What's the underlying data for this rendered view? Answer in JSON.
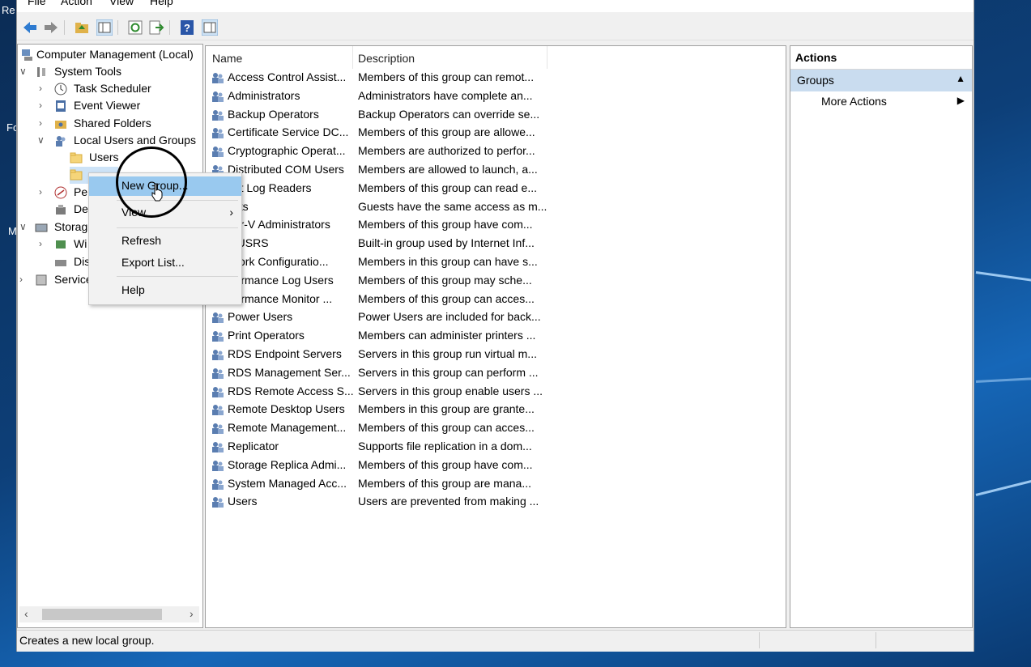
{
  "desktop": {
    "left_labels": [
      "Re",
      "Fo",
      "M"
    ]
  },
  "menubar": {
    "items": [
      "File",
      "Action",
      "View",
      "Help"
    ]
  },
  "toolbar": {
    "buttons": [
      "back-icon",
      "forward-icon",
      "up-folder-icon",
      "show-hide-console-tree-icon",
      "refresh-icon",
      "export-list-icon",
      "help-icon",
      "show-hide-action-pane-icon"
    ]
  },
  "tree": {
    "root": "Computer Management (Local)",
    "system_tools": "System Tools",
    "task_scheduler": "Task Scheduler",
    "event_viewer": "Event Viewer",
    "shared_folders": "Shared Folders",
    "local_users_groups": "Local Users and Groups",
    "users": "Users",
    "performance": "Per",
    "device_manager": "Dev",
    "storage": "Storag",
    "windows_backup": "Wi",
    "disk_management": "Dis",
    "services": "Service"
  },
  "list": {
    "col_name": "Name",
    "col_description": "Description",
    "rows": [
      {
        "name": "Access Control Assist...",
        "desc": "Members of this group can remot..."
      },
      {
        "name": "Administrators",
        "desc": "Administrators have complete an..."
      },
      {
        "name": "Backup Operators",
        "desc": "Backup Operators can override se..."
      },
      {
        "name": "Certificate Service DC...",
        "desc": "Members of this group are allowe..."
      },
      {
        "name": "Cryptographic Operat...",
        "desc": "Members are authorized to perfor..."
      },
      {
        "name": "Distributed COM Users",
        "desc": "Members are allowed to launch, a..."
      },
      {
        "name": "ent Log Readers",
        "desc": "Members of this group can read e..."
      },
      {
        "name": "ests",
        "desc": "Guests have the same access as m..."
      },
      {
        "name": "per-V Administrators",
        "desc": "Members of this group have com..."
      },
      {
        "name": "_IUSRS",
        "desc": "Built-in group used by Internet Inf..."
      },
      {
        "name": "twork Configuratio...",
        "desc": "Members in this group can have s..."
      },
      {
        "name": "rformance Log Users",
        "desc": "Members of this group may sche..."
      },
      {
        "name": "rformance Monitor ...",
        "desc": "Members of this group can acces..."
      },
      {
        "name": "Power Users",
        "desc": "Power Users are included for back..."
      },
      {
        "name": "Print Operators",
        "desc": "Members can administer printers ..."
      },
      {
        "name": "RDS Endpoint Servers",
        "desc": "Servers in this group run virtual m..."
      },
      {
        "name": "RDS Management Ser...",
        "desc": "Servers in this group can perform ..."
      },
      {
        "name": "RDS Remote Access S...",
        "desc": "Servers in this group enable users ..."
      },
      {
        "name": "Remote Desktop Users",
        "desc": "Members in this group are grante..."
      },
      {
        "name": "Remote Management...",
        "desc": "Members of this group can acces..."
      },
      {
        "name": "Replicator",
        "desc": "Supports file replication in a dom..."
      },
      {
        "name": "Storage Replica Admi...",
        "desc": "Members of this group have com..."
      },
      {
        "name": "System Managed Acc...",
        "desc": "Members of this group are mana..."
      },
      {
        "name": "Users",
        "desc": "Users are prevented from making ..."
      }
    ]
  },
  "actions": {
    "title": "Actions",
    "section": "Groups",
    "more_actions": "More Actions"
  },
  "context_menu": {
    "new_group": "New Group...",
    "view": "View",
    "refresh": "Refresh",
    "export_list": "Export List...",
    "help": "Help"
  },
  "statusbar": {
    "text": "Creates a new local group."
  },
  "colors": {
    "selection": "#99c9ef",
    "actions_header": "#c9dcef",
    "window_bg": "#f0f0f0"
  }
}
